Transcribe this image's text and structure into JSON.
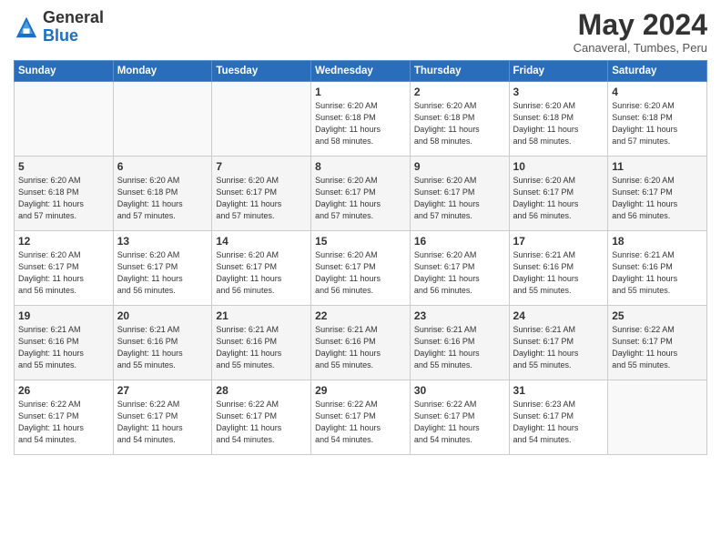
{
  "logo": {
    "general": "General",
    "blue": "Blue"
  },
  "header": {
    "month": "May 2024",
    "location": "Canaveral, Tumbes, Peru"
  },
  "days_of_week": [
    "Sunday",
    "Monday",
    "Tuesday",
    "Wednesday",
    "Thursday",
    "Friday",
    "Saturday"
  ],
  "weeks": [
    [
      {
        "day": "",
        "info": ""
      },
      {
        "day": "",
        "info": ""
      },
      {
        "day": "",
        "info": ""
      },
      {
        "day": "1",
        "info": "Sunrise: 6:20 AM\nSunset: 6:18 PM\nDaylight: 11 hours\nand 58 minutes."
      },
      {
        "day": "2",
        "info": "Sunrise: 6:20 AM\nSunset: 6:18 PM\nDaylight: 11 hours\nand 58 minutes."
      },
      {
        "day": "3",
        "info": "Sunrise: 6:20 AM\nSunset: 6:18 PM\nDaylight: 11 hours\nand 58 minutes."
      },
      {
        "day": "4",
        "info": "Sunrise: 6:20 AM\nSunset: 6:18 PM\nDaylight: 11 hours\nand 57 minutes."
      }
    ],
    [
      {
        "day": "5",
        "info": "Sunrise: 6:20 AM\nSunset: 6:18 PM\nDaylight: 11 hours\nand 57 minutes."
      },
      {
        "day": "6",
        "info": "Sunrise: 6:20 AM\nSunset: 6:18 PM\nDaylight: 11 hours\nand 57 minutes."
      },
      {
        "day": "7",
        "info": "Sunrise: 6:20 AM\nSunset: 6:17 PM\nDaylight: 11 hours\nand 57 minutes."
      },
      {
        "day": "8",
        "info": "Sunrise: 6:20 AM\nSunset: 6:17 PM\nDaylight: 11 hours\nand 57 minutes."
      },
      {
        "day": "9",
        "info": "Sunrise: 6:20 AM\nSunset: 6:17 PM\nDaylight: 11 hours\nand 57 minutes."
      },
      {
        "day": "10",
        "info": "Sunrise: 6:20 AM\nSunset: 6:17 PM\nDaylight: 11 hours\nand 56 minutes."
      },
      {
        "day": "11",
        "info": "Sunrise: 6:20 AM\nSunset: 6:17 PM\nDaylight: 11 hours\nand 56 minutes."
      }
    ],
    [
      {
        "day": "12",
        "info": "Sunrise: 6:20 AM\nSunset: 6:17 PM\nDaylight: 11 hours\nand 56 minutes."
      },
      {
        "day": "13",
        "info": "Sunrise: 6:20 AM\nSunset: 6:17 PM\nDaylight: 11 hours\nand 56 minutes."
      },
      {
        "day": "14",
        "info": "Sunrise: 6:20 AM\nSunset: 6:17 PM\nDaylight: 11 hours\nand 56 minutes."
      },
      {
        "day": "15",
        "info": "Sunrise: 6:20 AM\nSunset: 6:17 PM\nDaylight: 11 hours\nand 56 minutes."
      },
      {
        "day": "16",
        "info": "Sunrise: 6:20 AM\nSunset: 6:17 PM\nDaylight: 11 hours\nand 56 minutes."
      },
      {
        "day": "17",
        "info": "Sunrise: 6:21 AM\nSunset: 6:16 PM\nDaylight: 11 hours\nand 55 minutes."
      },
      {
        "day": "18",
        "info": "Sunrise: 6:21 AM\nSunset: 6:16 PM\nDaylight: 11 hours\nand 55 minutes."
      }
    ],
    [
      {
        "day": "19",
        "info": "Sunrise: 6:21 AM\nSunset: 6:16 PM\nDaylight: 11 hours\nand 55 minutes."
      },
      {
        "day": "20",
        "info": "Sunrise: 6:21 AM\nSunset: 6:16 PM\nDaylight: 11 hours\nand 55 minutes."
      },
      {
        "day": "21",
        "info": "Sunrise: 6:21 AM\nSunset: 6:16 PM\nDaylight: 11 hours\nand 55 minutes."
      },
      {
        "day": "22",
        "info": "Sunrise: 6:21 AM\nSunset: 6:16 PM\nDaylight: 11 hours\nand 55 minutes."
      },
      {
        "day": "23",
        "info": "Sunrise: 6:21 AM\nSunset: 6:16 PM\nDaylight: 11 hours\nand 55 minutes."
      },
      {
        "day": "24",
        "info": "Sunrise: 6:21 AM\nSunset: 6:17 PM\nDaylight: 11 hours\nand 55 minutes."
      },
      {
        "day": "25",
        "info": "Sunrise: 6:22 AM\nSunset: 6:17 PM\nDaylight: 11 hours\nand 55 minutes."
      }
    ],
    [
      {
        "day": "26",
        "info": "Sunrise: 6:22 AM\nSunset: 6:17 PM\nDaylight: 11 hours\nand 54 minutes."
      },
      {
        "day": "27",
        "info": "Sunrise: 6:22 AM\nSunset: 6:17 PM\nDaylight: 11 hours\nand 54 minutes."
      },
      {
        "day": "28",
        "info": "Sunrise: 6:22 AM\nSunset: 6:17 PM\nDaylight: 11 hours\nand 54 minutes."
      },
      {
        "day": "29",
        "info": "Sunrise: 6:22 AM\nSunset: 6:17 PM\nDaylight: 11 hours\nand 54 minutes."
      },
      {
        "day": "30",
        "info": "Sunrise: 6:22 AM\nSunset: 6:17 PM\nDaylight: 11 hours\nand 54 minutes."
      },
      {
        "day": "31",
        "info": "Sunrise: 6:23 AM\nSunset: 6:17 PM\nDaylight: 11 hours\nand 54 minutes."
      },
      {
        "day": "",
        "info": ""
      }
    ]
  ]
}
